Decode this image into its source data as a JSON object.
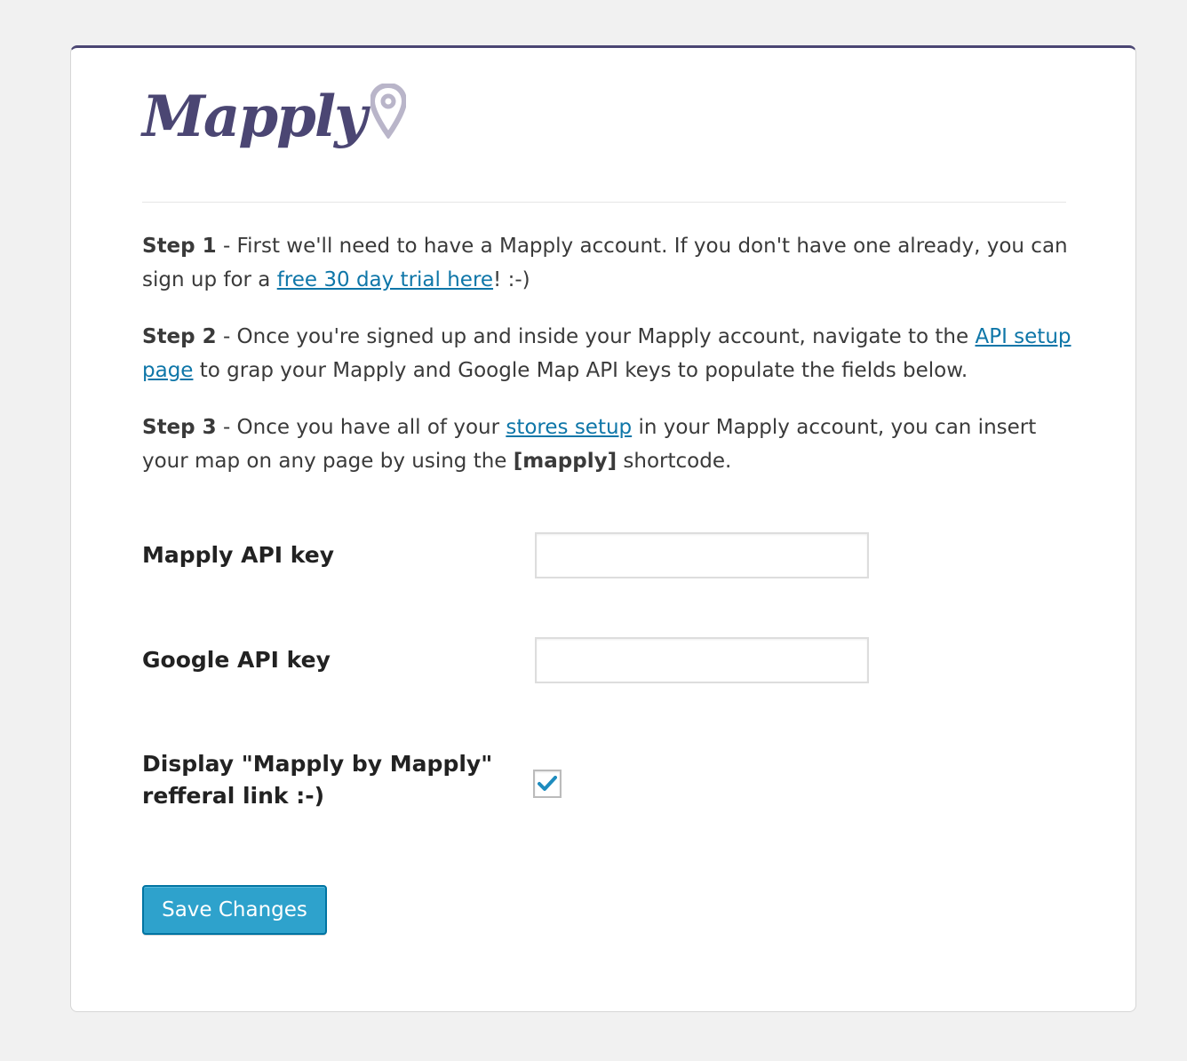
{
  "brand": {
    "name": "Mapply",
    "color": "#4b4673",
    "pin_color": "#b9b5c9"
  },
  "steps": [
    {
      "label": "Step 1",
      "text_before": " - First we'll need to have a Mapply account. If you don't have one already, you can sign up for a ",
      "link": "free 30 day trial here",
      "text_after": "! :-)"
    },
    {
      "label": "Step 2",
      "text_before": " - Once you're signed up and inside your Mapply account, navigate to the ",
      "link": "API setup page",
      "text_after": " to grap your Mapply and Google Map API keys to populate the fields below."
    },
    {
      "label": "Step 3",
      "text_before": " - Once you have all of your ",
      "link": "stores setup",
      "text_middle": " in your Mapply account, you can insert your map on any page by using the ",
      "shortcode": "[mapply]",
      "text_after": " shortcode."
    }
  ],
  "fields": {
    "mapply_api_key": {
      "label": "Mapply API key",
      "value": ""
    },
    "google_api_key": {
      "label": "Google API key",
      "value": ""
    },
    "referral_link": {
      "label_line1": "Display \"Mapply by Mapply\"",
      "label_line2": "refferal link :-)",
      "checked": true
    }
  },
  "save_button": {
    "label": "Save Changes"
  },
  "colors": {
    "link": "#0e76a8",
    "button": "#2ea2cc",
    "check": "#1e8cbe"
  }
}
